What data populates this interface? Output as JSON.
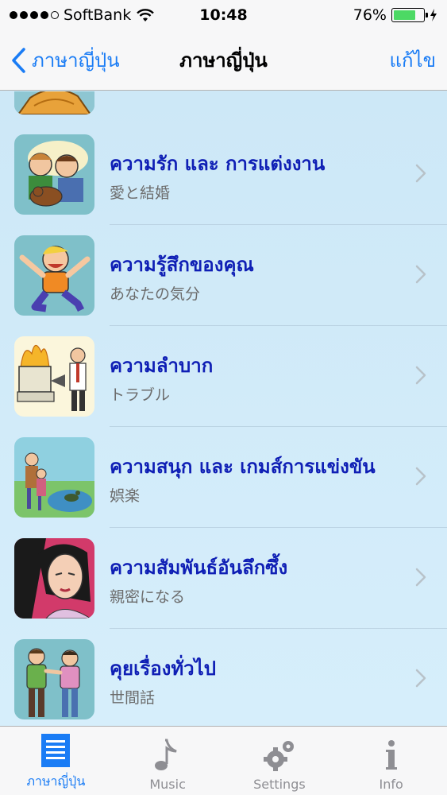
{
  "status_bar": {
    "carrier": "SoftBank",
    "time": "10:48",
    "battery": "76%",
    "battery_level": 0.76
  },
  "nav": {
    "back_label": "ภาษาญี่ปุ่น",
    "title": "ภาษาญี่ปุ่น",
    "edit_label": "แก้ไข"
  },
  "topics": [
    {
      "title": "ความรัก และ การแต่งงาน",
      "subtitle": "愛と結婚",
      "icon": "love-marriage-illustration"
    },
    {
      "title": "ความรู้สึกของคุณ",
      "subtitle": "あなたの気分",
      "icon": "happy-boy-illustration"
    },
    {
      "title": "ความลำบาก",
      "subtitle": "トラブル",
      "icon": "burning-computer-illustration"
    },
    {
      "title": "ความสนุก และ เกมส์การแข่งขัน",
      "subtitle": "娯楽",
      "icon": "family-park-illustration"
    },
    {
      "title": "ความสัมพันธ์อันลึกซึ้ง",
      "subtitle": "親密になる",
      "icon": "intimate-couple-illustration"
    },
    {
      "title": "คุยเรื่องทั่วไป",
      "subtitle": "世間話",
      "icon": "chatting-people-illustration"
    }
  ],
  "tabs": [
    {
      "label": "ภาษาญี่ปุ่น",
      "icon": "list-icon",
      "active": true
    },
    {
      "label": "Music",
      "icon": "music-note-icon",
      "active": false
    },
    {
      "label": "Settings",
      "icon": "gear-icon",
      "active": false
    },
    {
      "label": "Info",
      "icon": "info-icon",
      "active": false
    }
  ],
  "colors": {
    "accent": "#1a7cf5",
    "row_title": "#0f1fb5",
    "background": "#cfe9f8"
  }
}
